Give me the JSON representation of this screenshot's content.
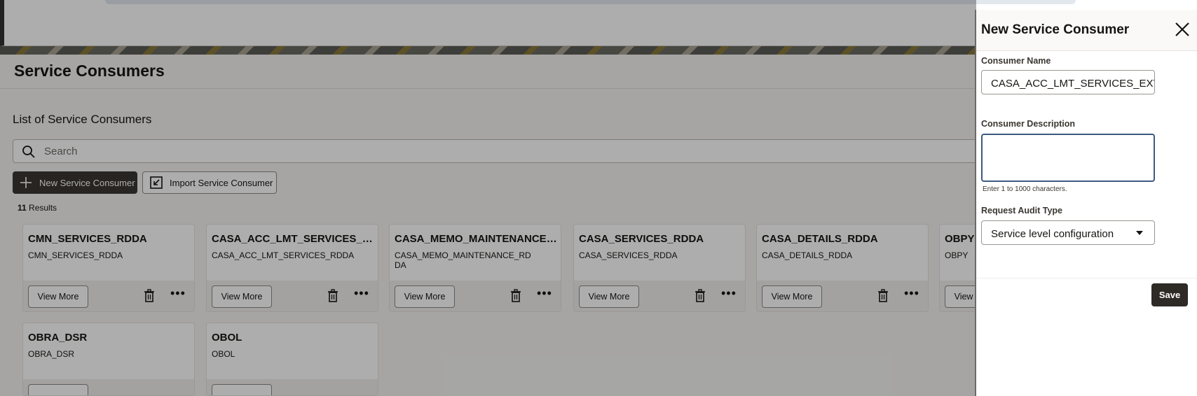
{
  "page": {
    "title": "Service Consumers"
  },
  "list": {
    "section_title": "List of Service Consumers",
    "search_placeholder": "Search",
    "new_button": "New Service Consumer",
    "import_button": "Import Service Consumer",
    "results_count": "11",
    "results_label": " Results",
    "view_more_label": "View More",
    "cards": [
      {
        "name": "CMN_SERVICES_RDDA",
        "desc": "CMN_SERVICES_RDDA"
      },
      {
        "name": "CASA_ACC_LMT_SERVICES_RDDA",
        "desc": "CASA_ACC_LMT_SERVICES_RDDA"
      },
      {
        "name": "CASA_MEMO_MAINTENANCE_R...",
        "desc": "CASA_MEMO_MAINTENANCE_RDDA"
      },
      {
        "name": "CASA_SERVICES_RDDA",
        "desc": "CASA_SERVICES_RDDA"
      },
      {
        "name": "CASA_DETAILS_RDDA",
        "desc": "CASA_DETAILS_RDDA"
      },
      {
        "name": "OBPY",
        "desc": "OBPY"
      },
      {
        "name": "OBRA_DSR",
        "desc": "OBRA_DSR"
      },
      {
        "name": "OBOL",
        "desc": "OBOL"
      }
    ]
  },
  "panel": {
    "title": "New Service Consumer",
    "consumer_name_label": "Consumer Name",
    "consumer_name_value": "CASA_ACC_LMT_SERVICES_EXT_P",
    "consumer_desc_label": "Consumer Description",
    "consumer_desc_value": "",
    "consumer_desc_hint": "Enter 1 to 1000 characters.",
    "audit_type_label": "Request Audit Type",
    "audit_type_value": "Service level configuration",
    "save_label": "Save"
  }
}
